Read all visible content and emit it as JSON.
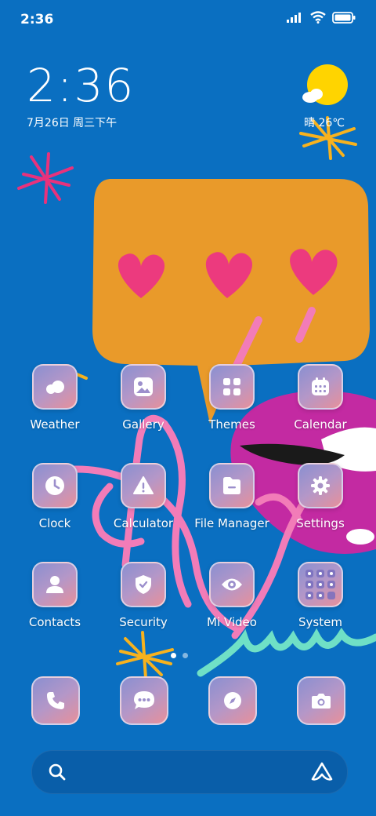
{
  "status_bar": {
    "time": "2:36",
    "icons": [
      "signal-icon",
      "wifi-icon",
      "battery-icon"
    ]
  },
  "clock_widget": {
    "time": "2:36",
    "date": "7月26日 周三下午"
  },
  "weather_widget": {
    "summary": "晴 26℃",
    "icon": "sun-cloud-icon"
  },
  "apps": [
    {
      "label": "Weather",
      "icon": "cloud-icon"
    },
    {
      "label": "Gallery",
      "icon": "image-icon"
    },
    {
      "label": "Themes",
      "icon": "grid-icon"
    },
    {
      "label": "Calendar",
      "icon": "calendar-icon"
    },
    {
      "label": "Clock",
      "icon": "clock-icon"
    },
    {
      "label": "Calculator",
      "icon": "warning-triangle-icon"
    },
    {
      "label": "File Manager",
      "icon": "folder-icon"
    },
    {
      "label": "Settings",
      "icon": "gear-icon"
    },
    {
      "label": "Contacts",
      "icon": "person-icon"
    },
    {
      "label": "Security",
      "icon": "shield-check-icon"
    },
    {
      "label": "Mi Video",
      "icon": "eye-icon"
    },
    {
      "label": "System",
      "icon": "folder-grid-icon"
    }
  ],
  "page_indicator": {
    "pages": 2,
    "active": 1
  },
  "dock": [
    {
      "icon": "phone-icon"
    },
    {
      "icon": "chat-bubble-icon"
    },
    {
      "icon": "compass-icon"
    },
    {
      "icon": "camera-icon"
    }
  ],
  "search_bar": {
    "left_icon": "search-icon",
    "right_icon": "assistant-icon"
  },
  "colors": {
    "background": "#0a6fc1",
    "speech_bubble": "#e99a2a",
    "hearts": "#ec3a7e",
    "lips": "#c32aa2",
    "squiggle_pink": "#f27cb8",
    "squiggle_mint": "#6fe0c6",
    "sun": "#ffd400"
  }
}
